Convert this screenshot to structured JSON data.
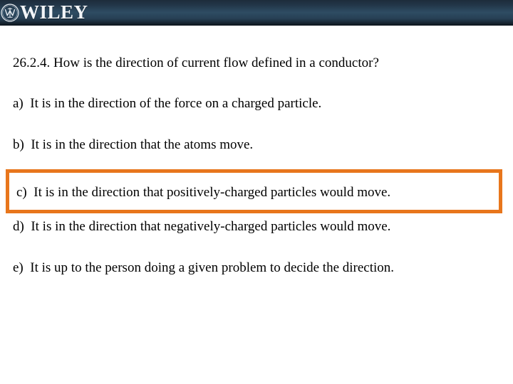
{
  "header": {
    "brand_name": "WILEY",
    "emblem_icon": "wiley-crest-icon",
    "background_color": "#2e4c63"
  },
  "slide": {
    "question": "26.2.4. How is the direction of current flow defined in a conductor?",
    "options": [
      {
        "label": "a)",
        "text": "It is in the direction of the force on a charged particle.",
        "highlighted": false
      },
      {
        "label": "b)",
        "text": "It is in the direction that the atoms move.",
        "highlighted": false
      },
      {
        "label": "c)",
        "text": "It is in the direction that positively-charged particles would move.",
        "highlighted": true
      },
      {
        "label": "d)",
        "text": "It is in the direction that negatively-charged particles would move.",
        "highlighted": false
      },
      {
        "label": "e)",
        "text": "It is up to the person doing a given problem to decide the direction.",
        "highlighted": false
      }
    ],
    "highlight_color": "#e8761c"
  }
}
